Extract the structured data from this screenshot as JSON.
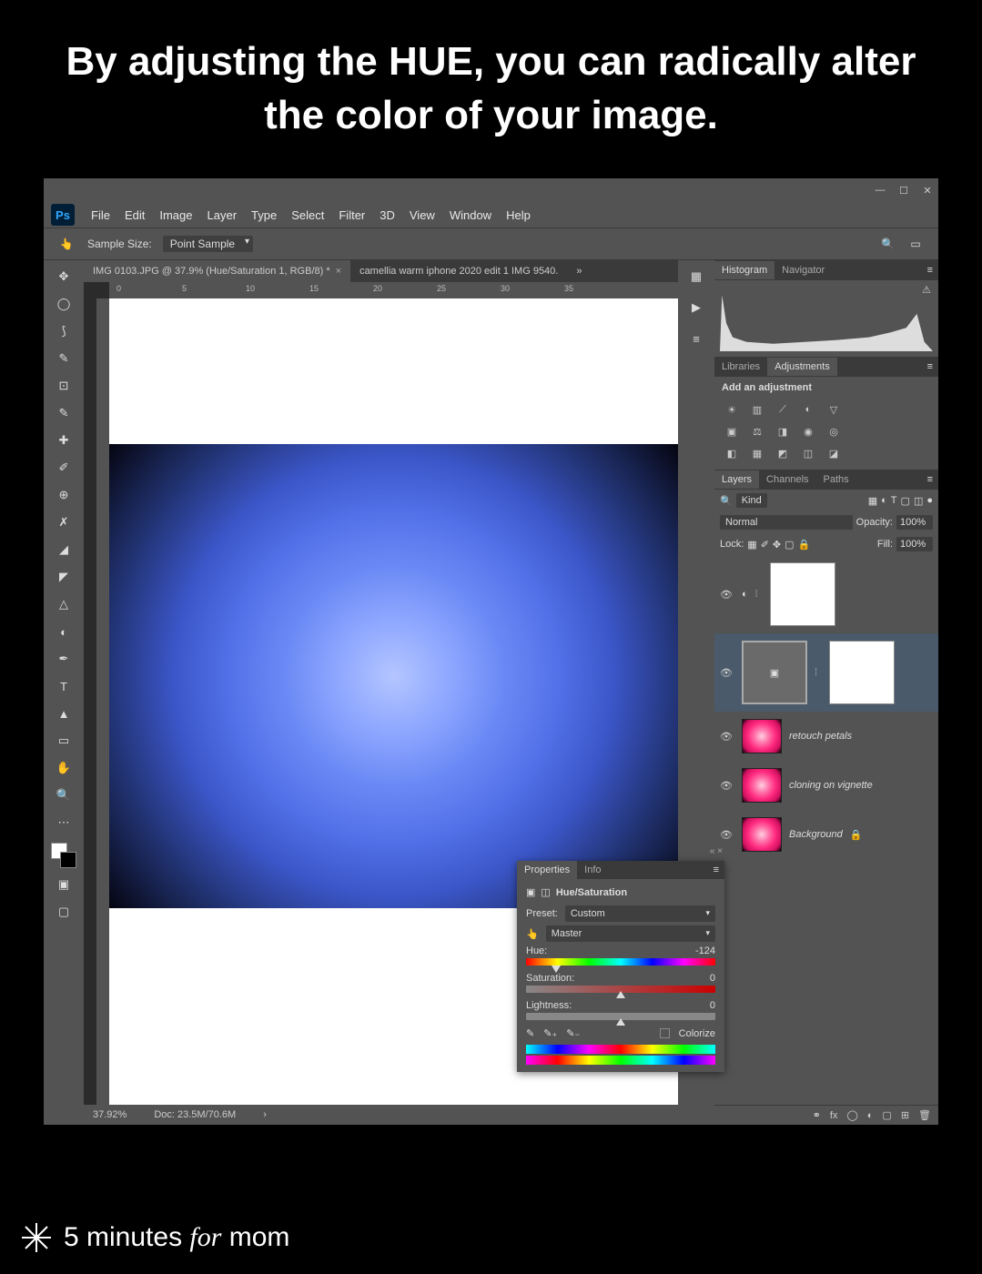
{
  "heading": "By adjusting the HUE, you can\nradically alter the color of your image.",
  "menu": [
    "File",
    "Edit",
    "Image",
    "Layer",
    "Type",
    "Select",
    "Filter",
    "3D",
    "View",
    "Window",
    "Help"
  ],
  "options": {
    "sample_size_label": "Sample Size:",
    "sample_size_value": "Point Sample"
  },
  "tabs": [
    {
      "label": "IMG 0103.JPG @ 37.9% (Hue/Saturation 1, RGB/8) *",
      "active": true
    },
    {
      "label": "camellia warm iphone 2020 edit 1 IMG 9540.",
      "active": false
    }
  ],
  "ruler_ticks": [
    0,
    5,
    10,
    15,
    20,
    25,
    30,
    35
  ],
  "status": {
    "zoom": "37.92%",
    "doc": "Doc: 23.5M/70.6M"
  },
  "panels": {
    "histogram_tabs": [
      "Histogram",
      "Navigator"
    ],
    "adjustments_tabs": [
      "Libraries",
      "Adjustments"
    ],
    "adjustments_label": "Add an adjustment",
    "layers_tabs": [
      "Layers",
      "Channels",
      "Paths"
    ],
    "kind_label": "Kind",
    "blend_mode": "Normal",
    "opacity_label": "Opacity:",
    "opacity_value": "100%",
    "lock_label": "Lock:",
    "fill_label": "Fill:",
    "fill_value": "100%",
    "layers": [
      {
        "type": "adjustment",
        "name": ""
      },
      {
        "type": "adjustment-selected",
        "name": ""
      },
      {
        "type": "image",
        "name": "retouch petals"
      },
      {
        "type": "image",
        "name": "cloning on vignette"
      },
      {
        "type": "image",
        "name": "Background",
        "locked": true
      }
    ]
  },
  "properties": {
    "tabs": [
      "Properties",
      "Info"
    ],
    "title": "Hue/Saturation",
    "preset_label": "Preset:",
    "preset_value": "Custom",
    "channel_value": "Master",
    "hue_label": "Hue:",
    "hue_value": "-124",
    "sat_label": "Saturation:",
    "sat_value": "0",
    "light_label": "Lightness:",
    "light_value": "0",
    "colorize_label": "Colorize"
  },
  "watermark": "5 minutes for mom"
}
